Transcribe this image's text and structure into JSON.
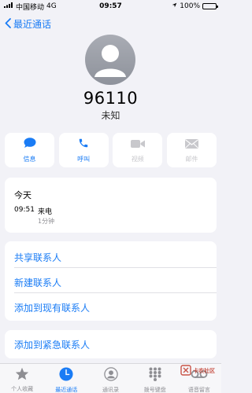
{
  "status": {
    "carrier": "中国移动",
    "network": "4G",
    "time": "09:57",
    "battery": "100%"
  },
  "nav": {
    "back_label": "最近通话"
  },
  "contact": {
    "number": "96110",
    "label": "未知"
  },
  "actions": [
    {
      "label": "信息",
      "icon": "message-icon",
      "enabled": true
    },
    {
      "label": "呼叫",
      "icon": "phone-icon",
      "enabled": true
    },
    {
      "label": "视频",
      "icon": "video-icon",
      "enabled": false
    },
    {
      "label": "邮件",
      "icon": "mail-icon",
      "enabled": false
    }
  ],
  "history": {
    "day": "今天",
    "time": "09:51",
    "type": "来电",
    "duration": "1分钟"
  },
  "links": [
    "共享联系人",
    "新建联系人",
    "添加到现有联系人"
  ],
  "emergency_link": "添加到紧急联系人",
  "tabs": [
    {
      "label": "个人收藏",
      "icon": "star-icon",
      "active": false
    },
    {
      "label": "最近通话",
      "icon": "clock-icon",
      "active": true
    },
    {
      "label": "通讯录",
      "icon": "contacts-icon",
      "active": false
    },
    {
      "label": "拨号键盘",
      "icon": "keypad-icon",
      "active": false
    },
    {
      "label": "语音留言",
      "icon": "voicemail-icon",
      "active": false
    }
  ],
  "watermark": {
    "text": "卡农社区"
  },
  "colors": {
    "accent": "#1a7cf5",
    "background": "#f2f2f7",
    "disabled": "#c8c8cc"
  }
}
